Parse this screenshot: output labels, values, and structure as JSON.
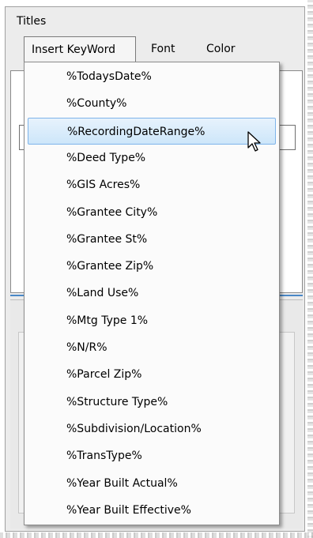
{
  "window": {
    "title": "Titles"
  },
  "menubar": {
    "items": [
      {
        "label": "Insert KeyWord"
      },
      {
        "label": "Font"
      },
      {
        "label": "Color"
      }
    ]
  },
  "dropdown": {
    "highlighted_index": 2,
    "items": [
      {
        "label": "%TodaysDate%"
      },
      {
        "label": "%County%"
      },
      {
        "label": "%RecordingDateRange%"
      },
      {
        "label": "%Deed Type%"
      },
      {
        "label": "%GIS Acres%"
      },
      {
        "label": "%Grantee City%"
      },
      {
        "label": "%Grantee St%"
      },
      {
        "label": "%Grantee Zip%"
      },
      {
        "label": "%Land Use%"
      },
      {
        "label": "%Mtg Type 1%"
      },
      {
        "label": "%N/R%"
      },
      {
        "label": "%Parcel Zip%"
      },
      {
        "label": "%Structure Type%"
      },
      {
        "label": "%Subdivision/Location%"
      },
      {
        "label": "%TransType%"
      },
      {
        "label": "%Year Built Actual%"
      },
      {
        "label": "%Year Built Effective%"
      }
    ]
  },
  "colors": {
    "highlight_border": "#7eb4ea",
    "highlight_fill": "#cde6fa",
    "selection_line": "#4a88c7"
  },
  "icons": {
    "pointer": "mouse-pointer-icon"
  }
}
